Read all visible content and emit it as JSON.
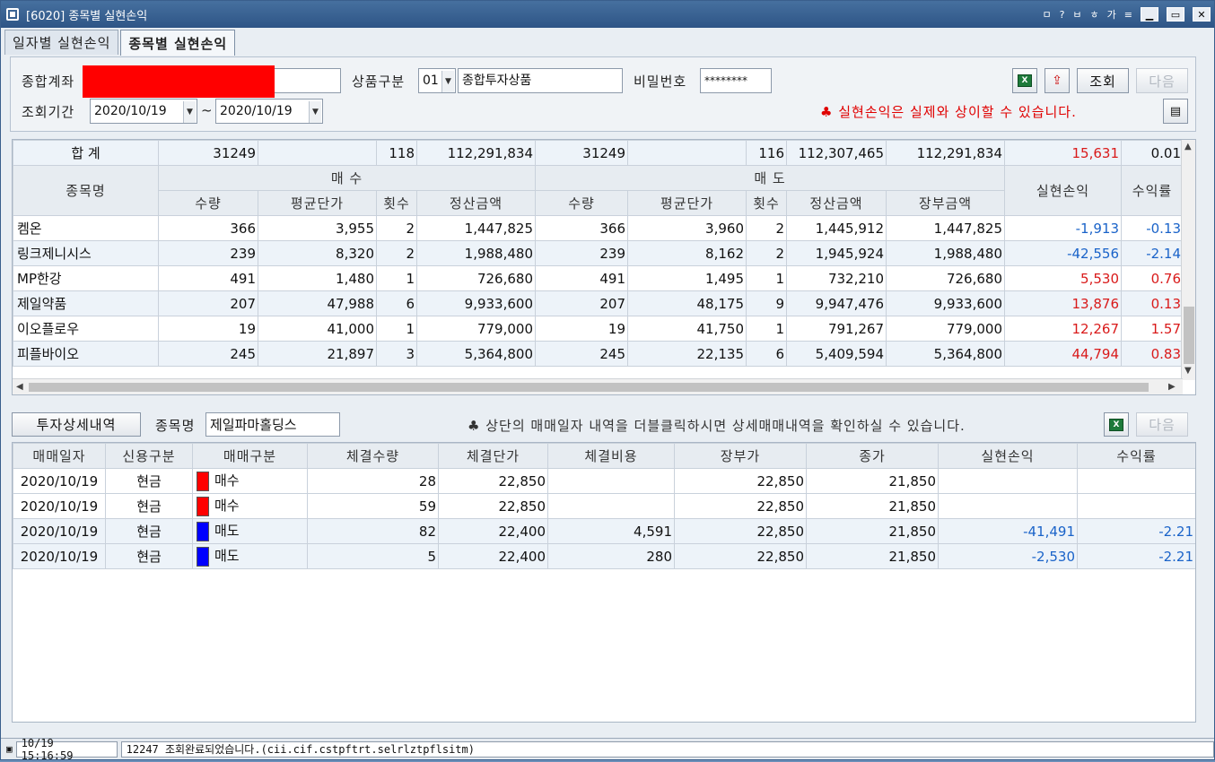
{
  "window": {
    "title": "[6020] 종목별 실현손익",
    "toolbar_glyphs": [
      "ㅁ",
      "?",
      "ㅂ",
      "ㅎ",
      "가"
    ]
  },
  "tabs": [
    {
      "label": "일자별 실현손익",
      "active": false
    },
    {
      "label": "종목별 실현손익",
      "active": true
    }
  ],
  "query": {
    "account_label": "종합계좌",
    "product_label": "상품구분",
    "product_code": "01",
    "product_name": "종합투자상품",
    "password_label": "비밀번호",
    "password_value": "********",
    "period_label": "조회기간",
    "date_from": "2020/10/19",
    "tilde": "~",
    "date_to": "2020/10/19",
    "search_button": "조회",
    "next_button": "다음",
    "warning": "♣ 실현손익은 실제와 상이할 수 있습니다."
  },
  "summary_table": {
    "total_row": {
      "label": "합  계",
      "buy_qty": "31249",
      "buy_avg": "",
      "buy_count": "118",
      "buy_amount": "112,291,834",
      "sell_qty": "31249",
      "sell_avg": "",
      "sell_count": "116",
      "sell_amount": "112,307,465",
      "book_amount": "112,291,834",
      "profit": "15,631",
      "rate": "0.01"
    },
    "header": {
      "name": "종목명",
      "buy_group": "매  수",
      "sell_group": "매  도",
      "profit": "실현손익",
      "rate": "수익률",
      "qty": "수량",
      "avg": "평균단가",
      "count": "횟수",
      "amount": "정산금액",
      "book": "장부금액"
    },
    "rows": [
      {
        "name": "켐온",
        "buy_qty": "366",
        "buy_avg": "3,955",
        "buy_count": "2",
        "buy_amount": "1,447,825",
        "sell_qty": "366",
        "sell_avg": "3,960",
        "sell_count": "2",
        "sell_amount": "1,445,912",
        "book_amount": "1,447,825",
        "profit": "-1,913",
        "rate": "-0.13",
        "sign": "neg"
      },
      {
        "name": "링크제니시스",
        "buy_qty": "239",
        "buy_avg": "8,320",
        "buy_count": "2",
        "buy_amount": "1,988,480",
        "sell_qty": "239",
        "sell_avg": "8,162",
        "sell_count": "2",
        "sell_amount": "1,945,924",
        "book_amount": "1,988,480",
        "profit": "-42,556",
        "rate": "-2.14",
        "sign": "neg"
      },
      {
        "name": "MP한강",
        "buy_qty": "491",
        "buy_avg": "1,480",
        "buy_count": "1",
        "buy_amount": "726,680",
        "sell_qty": "491",
        "sell_avg": "1,495",
        "sell_count": "1",
        "sell_amount": "732,210",
        "book_amount": "726,680",
        "profit": "5,530",
        "rate": "0.76",
        "sign": "pos"
      },
      {
        "name": "제일약품",
        "buy_qty": "207",
        "buy_avg": "47,988",
        "buy_count": "6",
        "buy_amount": "9,933,600",
        "sell_qty": "207",
        "sell_avg": "48,175",
        "sell_count": "9",
        "sell_amount": "9,947,476",
        "book_amount": "9,933,600",
        "profit": "13,876",
        "rate": "0.13",
        "sign": "pos"
      },
      {
        "name": "이오플로우",
        "buy_qty": "19",
        "buy_avg": "41,000",
        "buy_count": "1",
        "buy_amount": "779,000",
        "sell_qty": "19",
        "sell_avg": "41,750",
        "sell_count": "1",
        "sell_amount": "791,267",
        "book_amount": "779,000",
        "profit": "12,267",
        "rate": "1.57",
        "sign": "pos"
      },
      {
        "name": "피플바이오",
        "buy_qty": "245",
        "buy_avg": "21,897",
        "buy_count": "3",
        "buy_amount": "5,364,800",
        "sell_qty": "245",
        "sell_avg": "22,135",
        "sell_count": "6",
        "sell_amount": "5,409,594",
        "book_amount": "5,364,800",
        "profit": "44,794",
        "rate": "0.83",
        "sign": "pos"
      }
    ]
  },
  "detail": {
    "button": "투자상세내역",
    "stock_label": "종목명",
    "stock_name": "제일파마홀딩스",
    "hint": "♣ 상단의 매매일자 내역을 더블클릭하시면 상세매매내역을 확인하실 수 있습니다.",
    "next_button": "다음",
    "header": [
      "매매일자",
      "신용구분",
      "매매구분",
      "체결수량",
      "체결단가",
      "체결비용",
      "장부가",
      "종가",
      "실현손익",
      "수익률"
    ],
    "rows": [
      {
        "date": "2020/10/19",
        "credit": "현금",
        "side": "매수",
        "side_color": "#ff0000",
        "qty": "28",
        "price": "22,850",
        "cost": "",
        "book": "22,850",
        "close": "21,850",
        "profit": "",
        "rate": ""
      },
      {
        "date": "2020/10/19",
        "credit": "현금",
        "side": "매수",
        "side_color": "#ff0000",
        "qty": "59",
        "price": "22,850",
        "cost": "",
        "book": "22,850",
        "close": "21,850",
        "profit": "",
        "rate": ""
      },
      {
        "date": "2020/10/19",
        "credit": "현금",
        "side": "매도",
        "side_color": "#0000ff",
        "qty": "82",
        "price": "22,400",
        "cost": "4,591",
        "book": "22,850",
        "close": "21,850",
        "profit": "-41,491",
        "rate": "-2.21"
      },
      {
        "date": "2020/10/19",
        "credit": "현금",
        "side": "매도",
        "side_color": "#0000ff",
        "qty": "5",
        "price": "22,400",
        "cost": "280",
        "book": "22,850",
        "close": "21,850",
        "profit": "-2,530",
        "rate": "-2.21"
      }
    ]
  },
  "status": {
    "time": "10/19 15:16:59",
    "message": "12247 조회완료되었습니다.(cii.cif.cstpftrt.selrlztpflsitm)"
  },
  "colors": {
    "negative": "#1a63c9",
    "positive": "#d91a1a",
    "redacted": "#ff0000"
  }
}
